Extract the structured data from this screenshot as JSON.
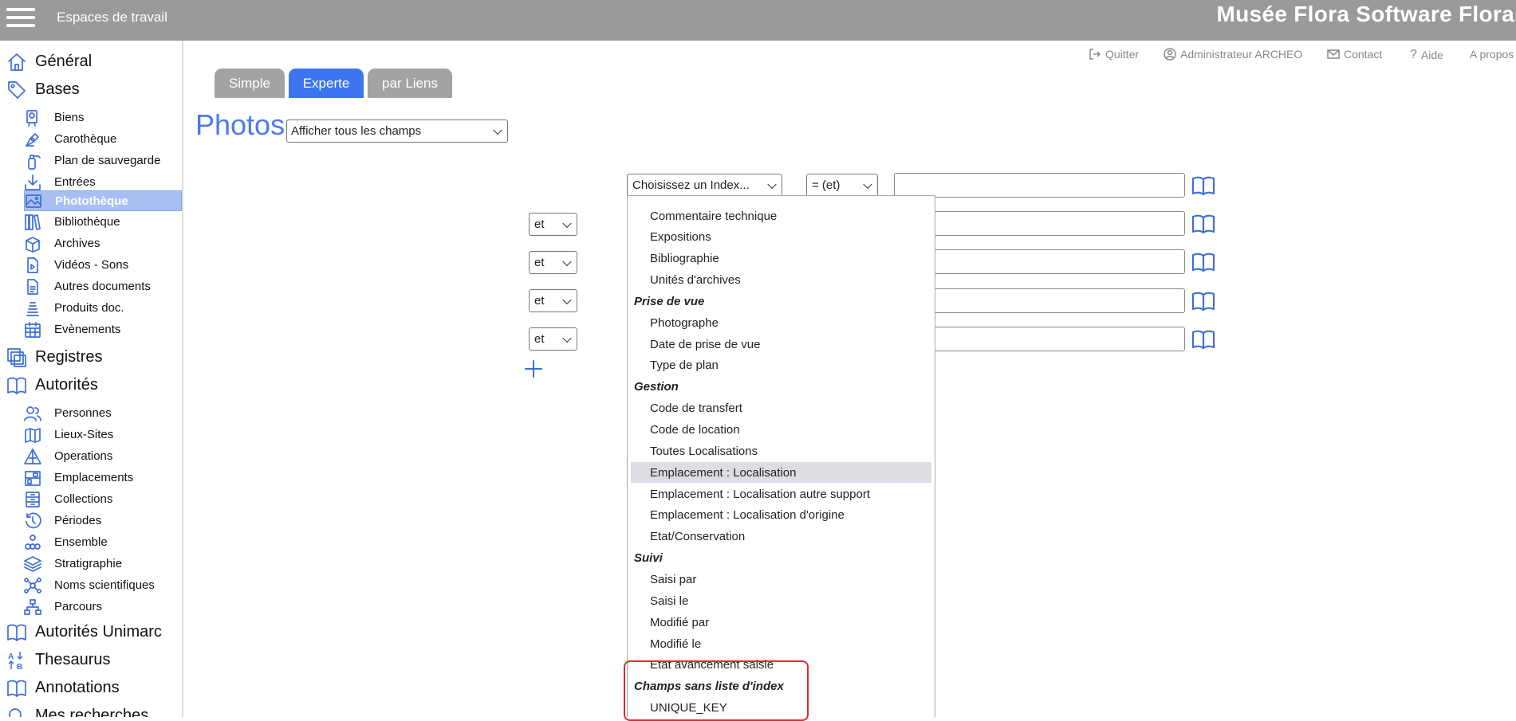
{
  "header": {
    "workspaces_label": "Espaces de travail",
    "brand": "Musée Flora Software Flora"
  },
  "sidebar": {
    "sections": [
      {
        "label": "Général",
        "icon": "home-icon"
      },
      {
        "label": "Bases",
        "icon": "tag-icon"
      },
      {
        "label": "Registres",
        "icon": "stack-icon"
      },
      {
        "label": "Autorités",
        "icon": "book-icon"
      },
      {
        "label": "Autorités Unimarc",
        "icon": "book-icon"
      },
      {
        "label": "Thesaurus",
        "icon": "sort-az-icon"
      },
      {
        "label": "Annotations",
        "icon": "book-icon"
      },
      {
        "label": "Mes recherches",
        "icon": "search-icon"
      }
    ],
    "bases_items": [
      {
        "label": "Biens",
        "icon": "certificate-icon"
      },
      {
        "label": "Carothèque",
        "icon": "pen-icon"
      },
      {
        "label": "Plan de sauvegarde",
        "icon": "extinguisher-icon"
      },
      {
        "label": "Entrées",
        "icon": "download-icon"
      },
      {
        "label": "Photothèque",
        "icon": "image-icon",
        "active": true
      },
      {
        "label": "Bibliothèque",
        "icon": "books-icon"
      },
      {
        "label": "Archives",
        "icon": "archive-box-icon"
      },
      {
        "label": "Vidéos - Sons",
        "icon": "video-file-icon"
      },
      {
        "label": "Autres documents",
        "icon": "document-icon"
      },
      {
        "label": "Produits doc.",
        "icon": "stack-docs-icon"
      },
      {
        "label": "Evènements",
        "icon": "calendar-icon"
      }
    ],
    "autorites_items": [
      {
        "label": "Personnes",
        "icon": "users-icon"
      },
      {
        "label": "Lieux-Sites",
        "icon": "map-icon"
      },
      {
        "label": "Operations",
        "icon": "pyramid-icon"
      },
      {
        "label": "Emplacements",
        "icon": "shelf-icon"
      },
      {
        "label": "Collections",
        "icon": "cabinet-icon"
      },
      {
        "label": "Périodes",
        "icon": "history-icon"
      },
      {
        "label": "Ensemble",
        "icon": "cluster-icon"
      },
      {
        "label": "Stratigraphie",
        "icon": "layers-icon"
      },
      {
        "label": "Noms scientifiques",
        "icon": "molecule-icon"
      },
      {
        "label": "Parcours",
        "icon": "hierarchy-icon"
      }
    ]
  },
  "toplinks": {
    "quit": "Quitter",
    "admin": "Administrateur ARCHEO",
    "contact": "Contact",
    "help": "Aide",
    "about": "A propos"
  },
  "tabs": [
    {
      "label": "Simple",
      "active": false
    },
    {
      "label": "Experte",
      "active": true
    },
    {
      "label": "par Liens",
      "active": false
    }
  ],
  "page": {
    "title": "Photos",
    "display_select": "Afficher tous les champs"
  },
  "query": {
    "index_select": "Choisissez un Index...",
    "operator_select": "= (et)",
    "connectors": [
      "et",
      "et",
      "et",
      "et"
    ]
  },
  "dropdown": {
    "rows": [
      {
        "label": "Commentaire technique",
        "group": false
      },
      {
        "label": "Expositions",
        "group": false
      },
      {
        "label": "Bibliographie",
        "group": false
      },
      {
        "label": "Unités d'archives",
        "group": false
      },
      {
        "label": "Prise de vue",
        "group": true
      },
      {
        "label": "Photographe",
        "group": false
      },
      {
        "label": "Date de prise de vue",
        "group": false
      },
      {
        "label": "Type de plan",
        "group": false
      },
      {
        "label": "Gestion",
        "group": true
      },
      {
        "label": "Code de transfert",
        "group": false
      },
      {
        "label": "Code de location",
        "group": false
      },
      {
        "label": "Toutes Localisations",
        "group": false
      },
      {
        "label": "Emplacement : Localisation",
        "group": false,
        "highlighted": true
      },
      {
        "label": "Emplacement : Localisation autre support",
        "group": false
      },
      {
        "label": "Emplacement : Localisation d'origine",
        "group": false
      },
      {
        "label": "Etat/Conservation",
        "group": false
      },
      {
        "label": "Suivi",
        "group": true
      },
      {
        "label": "Saisi par",
        "group": false
      },
      {
        "label": "Saisi le",
        "group": false
      },
      {
        "label": "Modifié par",
        "group": false
      },
      {
        "label": "Modifié le",
        "group": false
      },
      {
        "label": "Etat avancement saisie",
        "group": false
      },
      {
        "label": "Champs sans liste d'index",
        "group": true
      },
      {
        "label": "UNIQUE_KEY",
        "group": false
      }
    ]
  },
  "colors": {
    "topbar": "#9a9a9a",
    "accent": "#3d74f0",
    "title": "#4d7bea",
    "icon": "#3d6fd8",
    "annotation_box": "#e02a2a"
  }
}
